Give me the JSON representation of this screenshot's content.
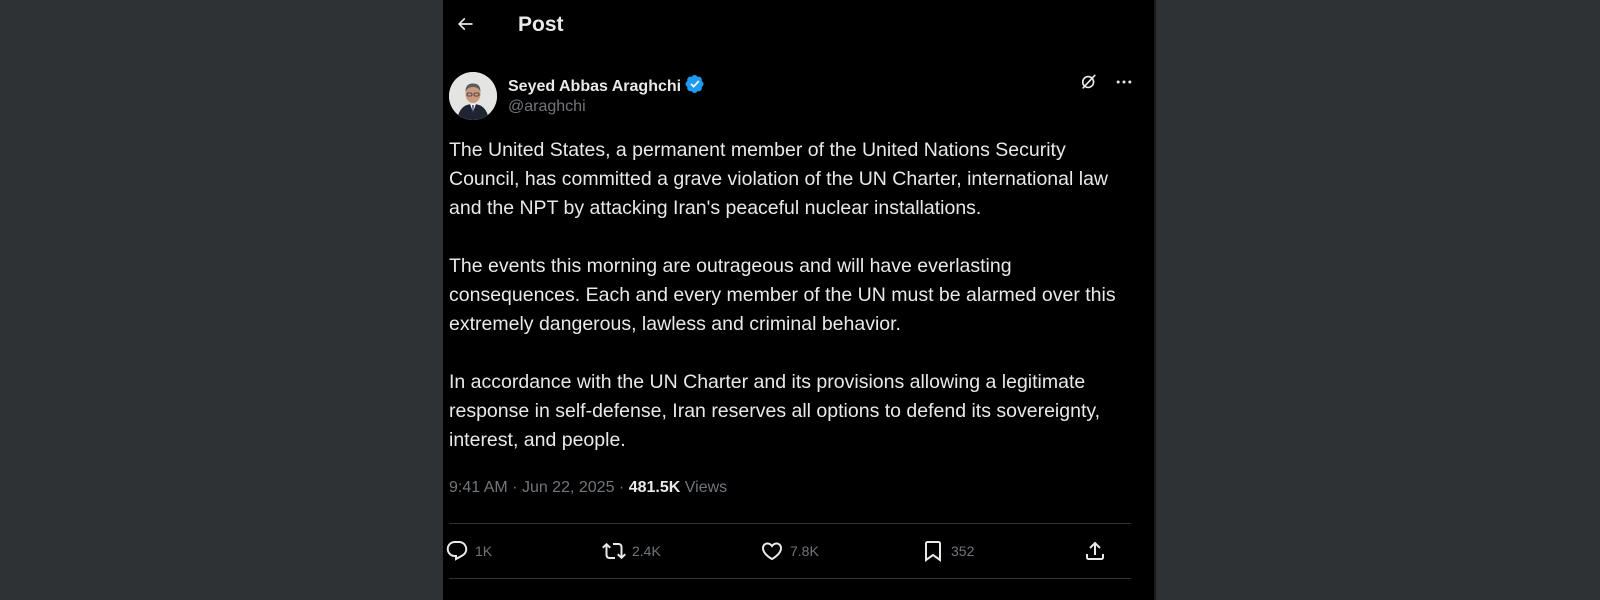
{
  "header": {
    "title": "Post"
  },
  "author": {
    "name": "Seyed Abbas Araghchi",
    "handle": "@araghchi",
    "verified": true
  },
  "post": {
    "paragraphs": [
      "The United States, a permanent member of the United Nations Security Council, has committed a grave violation of the UN Charter, international law and the NPT by attacking Iran's peaceful nuclear installations.",
      "The events this morning are outrageous and will have everlasting consequences. Each and every member of the UN must be alarmed over this extremely dangerous, lawless and criminal behavior.",
      "In accordance with the UN Charter and its provisions allowing a legitimate response in self-defense, Iran reserves all options to defend its sovereignty, interest, and people."
    ],
    "time": "9:41 AM",
    "date": "Jun 22, 2025",
    "separator": "·",
    "views_count": "481.5K",
    "views_label": "Views"
  },
  "actions": {
    "reply_count": "1K",
    "repost_count": "2.4K",
    "like_count": "7.8K",
    "bookmark_count": "352"
  },
  "icons": {
    "back": "arrow-left-icon",
    "grok": "grok-icon",
    "more": "more-horizontal-icon",
    "verified": "verified-badge-icon",
    "reply": "reply-icon",
    "repost": "repost-icon",
    "like": "heart-icon",
    "bookmark": "bookmark-icon",
    "share": "share-icon"
  },
  "colors": {
    "background": "#000000",
    "page_background": "#2f3234",
    "text_primary": "#e7e9ea",
    "text_secondary": "#71767b",
    "verified_blue": "#1d9bf0",
    "divider": "#2f3336"
  }
}
